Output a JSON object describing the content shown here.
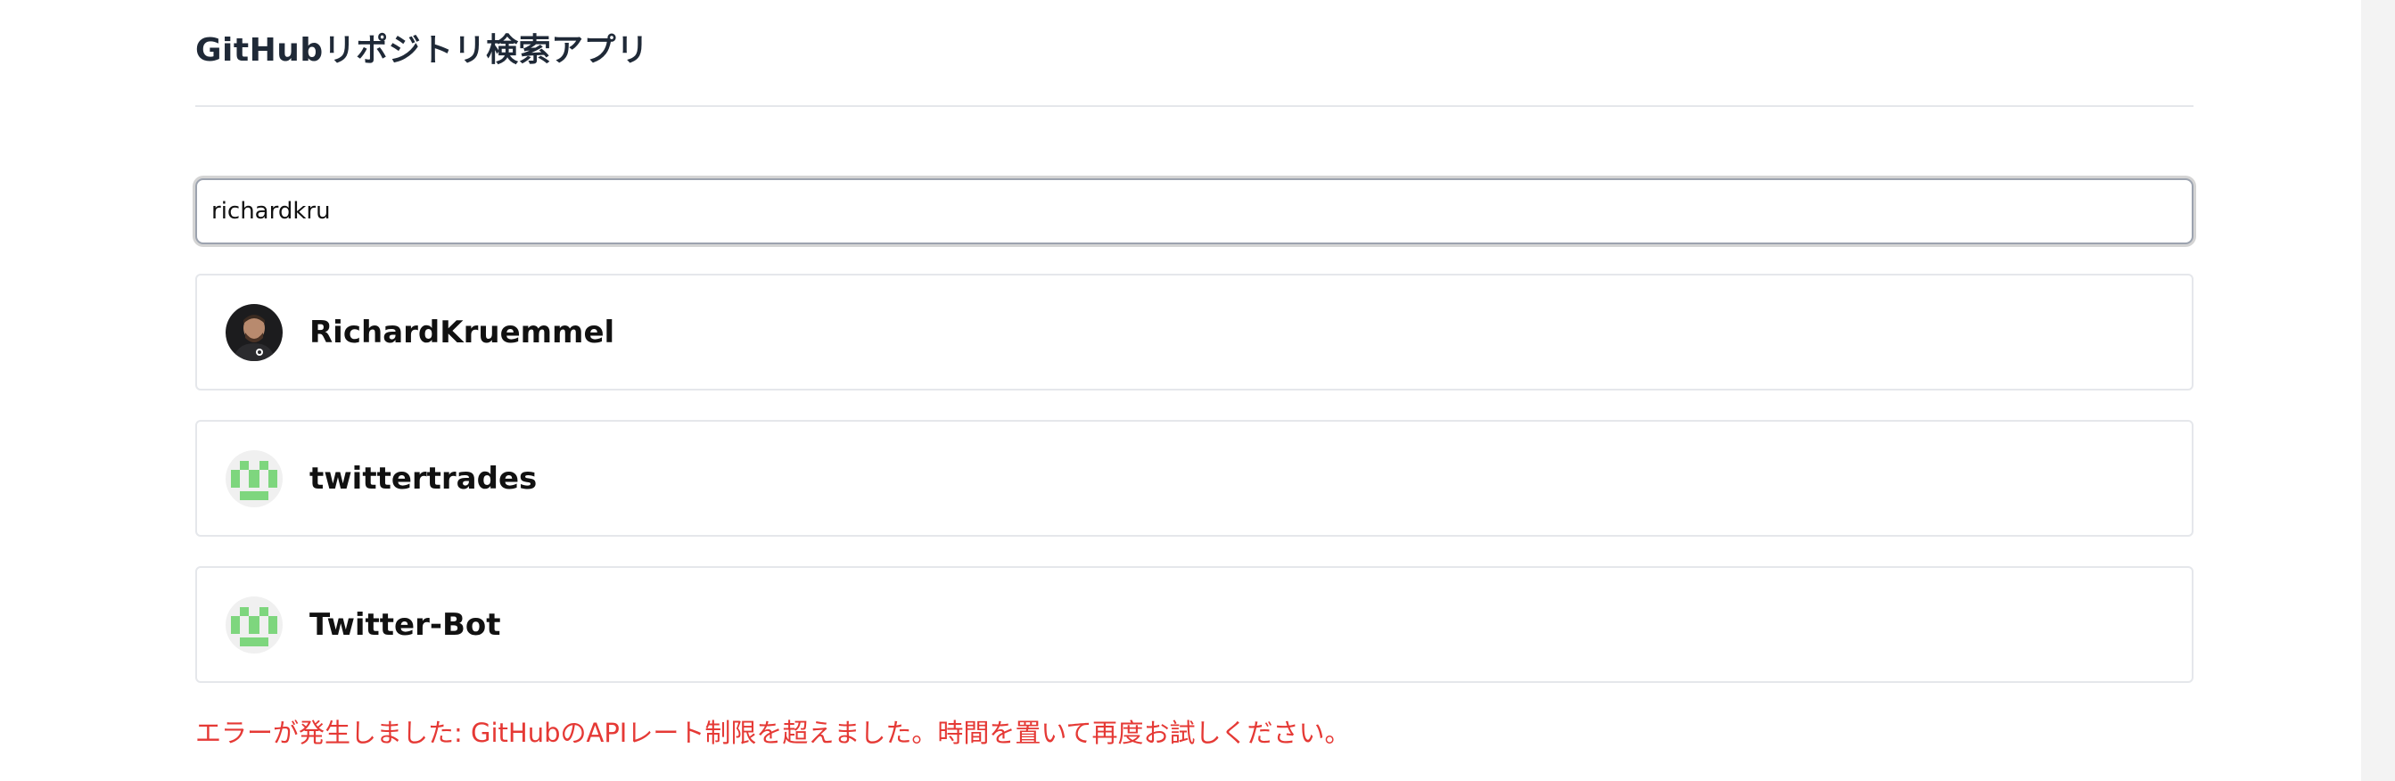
{
  "app": {
    "title": "GitHubリポジトリ検索アプリ"
  },
  "search": {
    "value": "richardkru",
    "placeholder": ""
  },
  "results": [
    {
      "username": "RichardKruemmel",
      "avatar": "photo-avatar"
    },
    {
      "username": "twittertrades",
      "avatar": "identicon-green"
    },
    {
      "username": "Twitter-Bot",
      "avatar": "identicon-green"
    }
  ],
  "error": {
    "message": "エラーが発生しました: GitHubのAPIレート制限を超えました。時間を置いて再度お試しください。"
  },
  "colors": {
    "error": "#e53935",
    "identicon": "#7ed67e",
    "border": "#e5e7eb"
  }
}
